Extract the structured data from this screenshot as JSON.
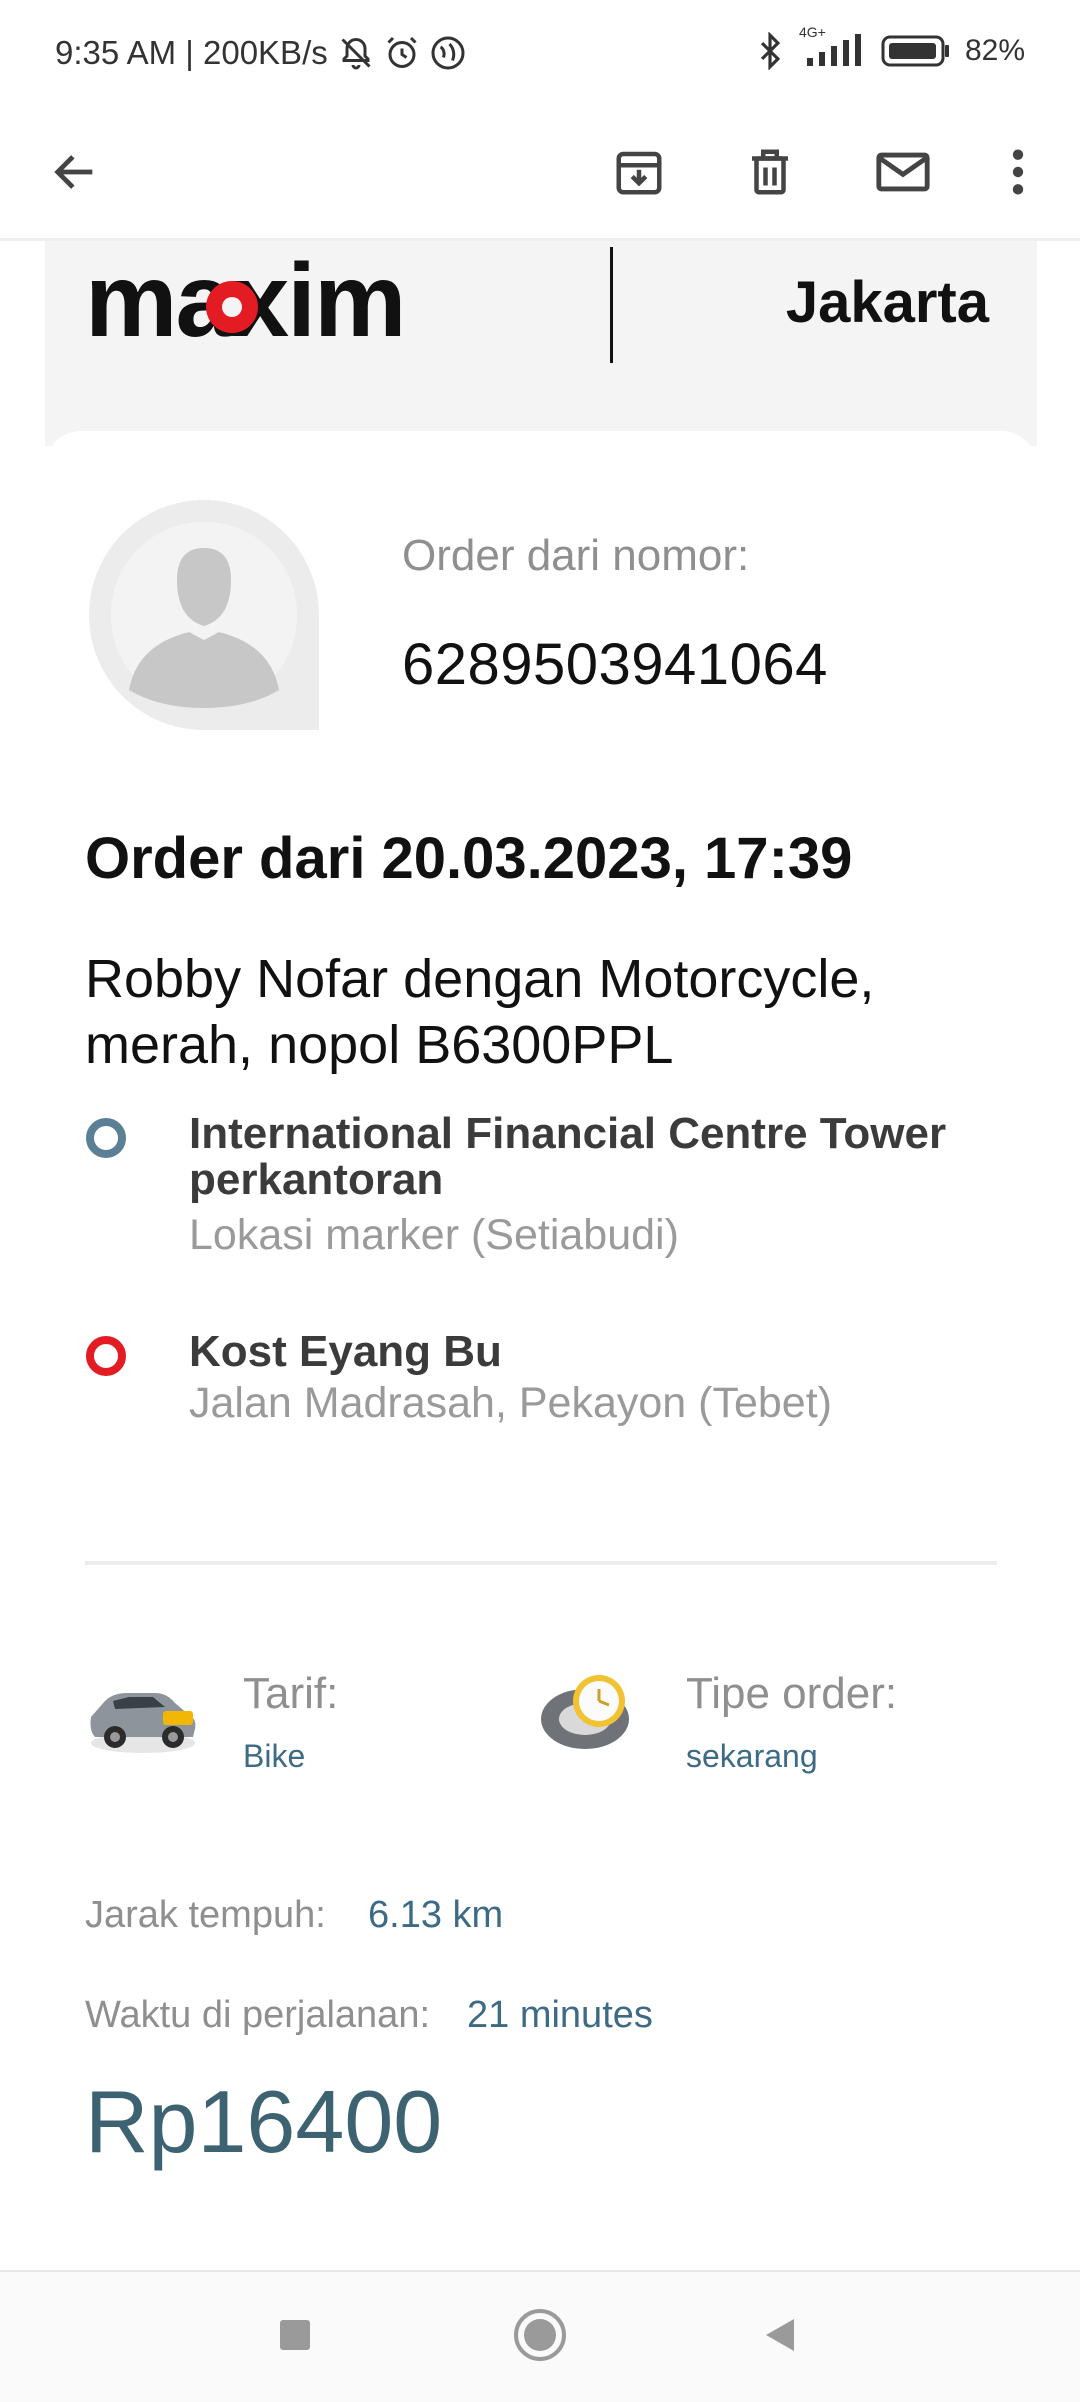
{
  "status_bar": {
    "time_speed": "9:35 AM | 200KB/s",
    "network": "4G+",
    "battery": "82%"
  },
  "app_bar": {
    "icons": [
      "back-arrow-icon",
      "archive-icon",
      "trash-icon",
      "mail-icon",
      "more-vert-icon"
    ]
  },
  "email": {
    "brand": "maxim",
    "city": "Jakarta",
    "order_from_label": "Order dari nomor:",
    "phone_number": "6289503941064",
    "order_date": "Order dari 20.03.2023, 17:39",
    "driver_info": "Robby Nofar dengan Motorcycle, merah, nopol B6300PPL",
    "route": [
      {
        "title": "International Financial Centre Tower perkantoran",
        "subtitle": "Lokasi marker (Setiabudi)",
        "dot_color": "#5b7f95"
      },
      {
        "title": "Kost Eyang Bu",
        "subtitle": "Jalan Madrasah, Pekayon (Tebet)",
        "dot_color": "#e31b23"
      }
    ],
    "tarif_label": "Tarif:",
    "tarif_value": "Bike",
    "order_type_label": "Tipe order:",
    "order_type_value": "sekarang",
    "distance_label": "Jarak tempuh:",
    "distance_value": "6.13 km",
    "duration_label": "Waktu di perjalanan:",
    "duration_value": "21 minutes",
    "price": "Rp16400"
  },
  "colors": {
    "brand_red": "#e31b23",
    "accent_blue": "#3d6b86"
  }
}
